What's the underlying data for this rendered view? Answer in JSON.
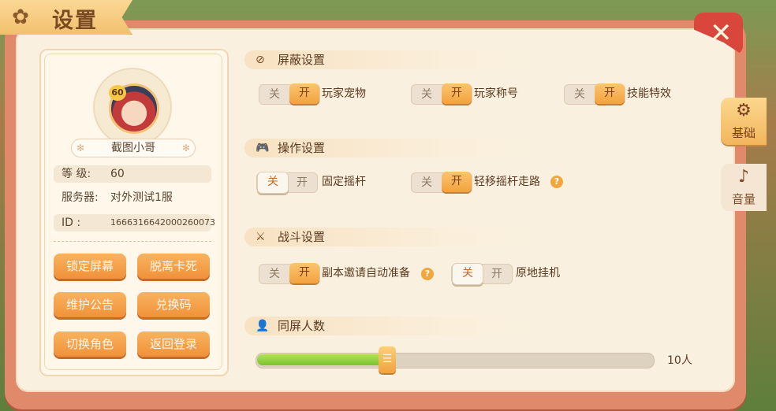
{
  "window": {
    "title": "设置"
  },
  "close": {
    "icon": "close-icon"
  },
  "profile": {
    "level_badge": "60",
    "name": "截图小哥",
    "level_label": "等  级:",
    "level_value": "60",
    "server_label": "服务器:",
    "server_value": "对外测试1服",
    "id_label": "ID  :",
    "id_value": "1666316642000260073",
    "buttons": [
      {
        "label": "锁定屏幕"
      },
      {
        "label": "脱离卡死"
      },
      {
        "label": "维护公告"
      },
      {
        "label": "兑换码"
      },
      {
        "label": "切换角色"
      },
      {
        "label": "返回登录"
      }
    ]
  },
  "sections": {
    "block": {
      "title": "屏蔽设置",
      "icon": "block-icon",
      "toggles": [
        {
          "label": "玩家宠物",
          "state": "on"
        },
        {
          "label": "玩家称号",
          "state": "on"
        },
        {
          "label": "技能特效",
          "state": "on"
        }
      ]
    },
    "control": {
      "title": "操作设置",
      "icon": "gamepad-icon",
      "toggles": [
        {
          "label": "固定摇杆",
          "state": "off"
        },
        {
          "label": "轻移摇杆走路",
          "state": "on"
        }
      ]
    },
    "battle": {
      "title": "战斗设置",
      "icon": "sword-icon",
      "toggles": [
        {
          "label": "副本邀请自动准备",
          "state": "on"
        },
        {
          "label": "原地挂机",
          "state": "off"
        }
      ]
    },
    "players": {
      "title": "同屏人数",
      "icon": "people-icon",
      "slider_fraction": 0.33,
      "value_text": "10人"
    }
  },
  "toggle_text": {
    "off": "关",
    "on": "开"
  },
  "help_glyph": "?",
  "tabs": [
    {
      "label": "基础",
      "icon": "gears-icon",
      "active": true
    },
    {
      "label": "音量",
      "icon": "music-icon",
      "active": false
    }
  ]
}
